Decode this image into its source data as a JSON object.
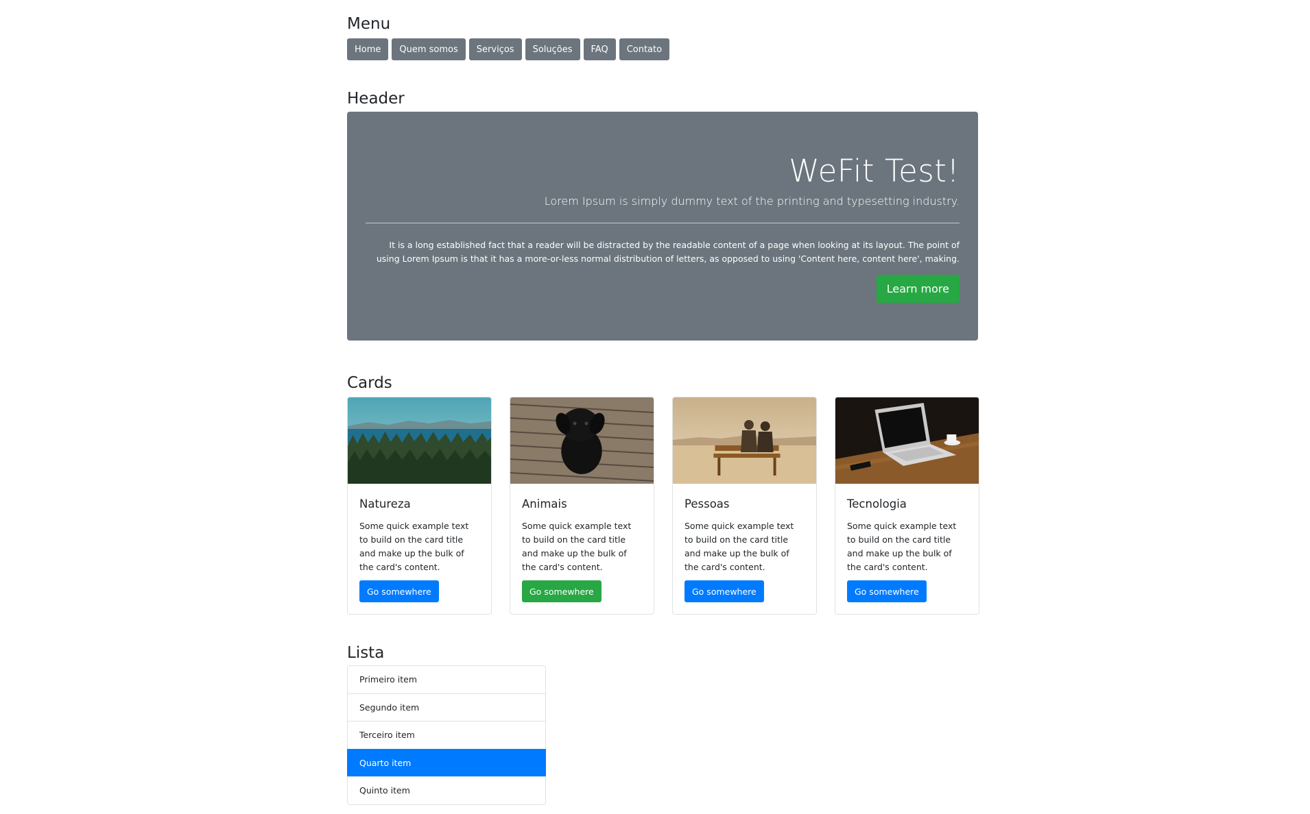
{
  "menu": {
    "title": "Menu",
    "items": [
      {
        "label": "Home"
      },
      {
        "label": "Quem somos"
      },
      {
        "label": "Serviços"
      },
      {
        "label": "Soluções"
      },
      {
        "label": "FAQ"
      },
      {
        "label": "Contato"
      }
    ]
  },
  "header": {
    "title": "Header",
    "jumbotron": {
      "heading": "WeFit Test!",
      "lead": "Lorem Ipsum is simply dummy text of the printing and typesetting industry.",
      "text": "It is a long established fact that a reader will be distracted by the readable content of a page when looking at its layout. The point of using Lorem Ipsum is that it has a more-or-less normal distribution of letters, as opposed to using 'Content here, content here', making.",
      "button_label": "Learn more",
      "bg_color": "#6c757d",
      "button_color": "#28a745"
    }
  },
  "cards": {
    "title": "Cards",
    "items": [
      {
        "title": "Natureza",
        "text": "Some quick example text to build on the card title and make up the bulk of the card's content.",
        "button_label": "Go somewhere",
        "button_color": "#007bff",
        "image": "forest-lake-photo"
      },
      {
        "title": "Animais",
        "text": "Some quick example text to build on the card title and make up the bulk of the card's content.",
        "button_label": "Go somewhere",
        "button_color": "#28a745",
        "image": "black-dog-photo"
      },
      {
        "title": "Pessoas",
        "text": "Some quick example text to build on the card title and make up the bulk of the card's content.",
        "button_label": "Go somewhere",
        "button_color": "#007bff",
        "image": "couple-bench-photo"
      },
      {
        "title": "Tecnologia",
        "text": "Some quick example text to build on the card title and make up the bulk of the card's content.",
        "button_label": "Go somewhere",
        "button_color": "#007bff",
        "image": "laptop-desk-photo"
      }
    ]
  },
  "list": {
    "title": "Lista",
    "items": [
      {
        "label": "Primeiro item",
        "active": false
      },
      {
        "label": "Segundo item",
        "active": false
      },
      {
        "label": "Terceiro item",
        "active": false
      },
      {
        "label": "Quarto item",
        "active": true
      },
      {
        "label": "Quinto item",
        "active": false
      }
    ],
    "active_color": "#007bff"
  }
}
